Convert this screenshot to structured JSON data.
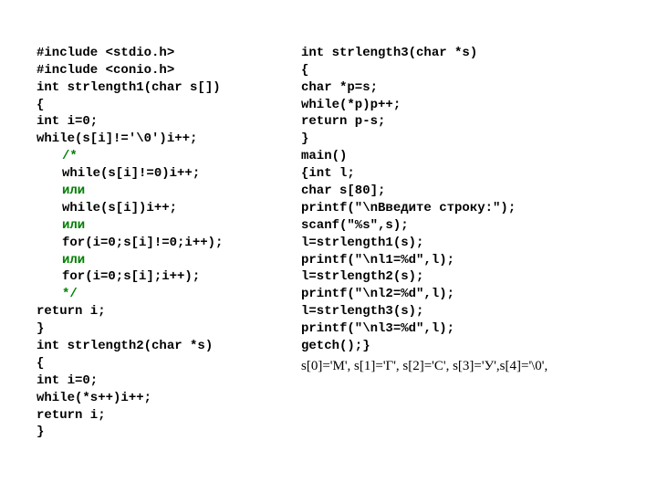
{
  "left": {
    "l1": "#include <stdio.h>",
    "l2": "#include <conio.h>",
    "l3": "int strlength1(char s[])",
    "l4": "{",
    "l5": "int i=0;",
    "l6": "while(s[i]!='\\0')i++;",
    "c1": "/*",
    "c2": "while(s[i]!=0)i++;",
    "c3": "или",
    "c4": "while(s[i])i++;",
    "c5": "или",
    "c6": "for(i=0;s[i]!=0;i++);",
    "c7": "или",
    "c8": "for(i=0;s[i];i++);",
    "c9": "*/",
    "l7": "return i;",
    "l8": "}",
    "l9": "int strlength2(char *s)",
    "l10": "{",
    "l11": "int i=0;",
    "l12": "while(*s++)i++;",
    "l13": "return i;",
    "l14": "}"
  },
  "right": {
    "r1": "int strlength3(char *s)",
    "r2": "{",
    "r3": "char *p=s;",
    "r4": "while(*p)p++;",
    "r5": "return p-s;",
    "r6": "}",
    "r7": "main()",
    "r8": "{int l;",
    "r9": "char s[80];",
    "r10": "printf(\"\\nВведите строку:\");",
    "r11": "scanf(\"%s\",s);",
    "r12": "l=strlength1(s);",
    "r13": "printf(\"\\nl1=%d\",l);",
    "r14": "l=strlength2(s);",
    "r15": "printf(\"\\nl2=%d\",l);",
    "r16": "l=strlength3(s);",
    "r17": "printf(\"\\nl3=%d\",l);",
    "r18": "getch();}",
    "bottom": "s[0]='М', s[1]='Г', s[2]='С', s[3]='У',s[4]='\\0',"
  }
}
